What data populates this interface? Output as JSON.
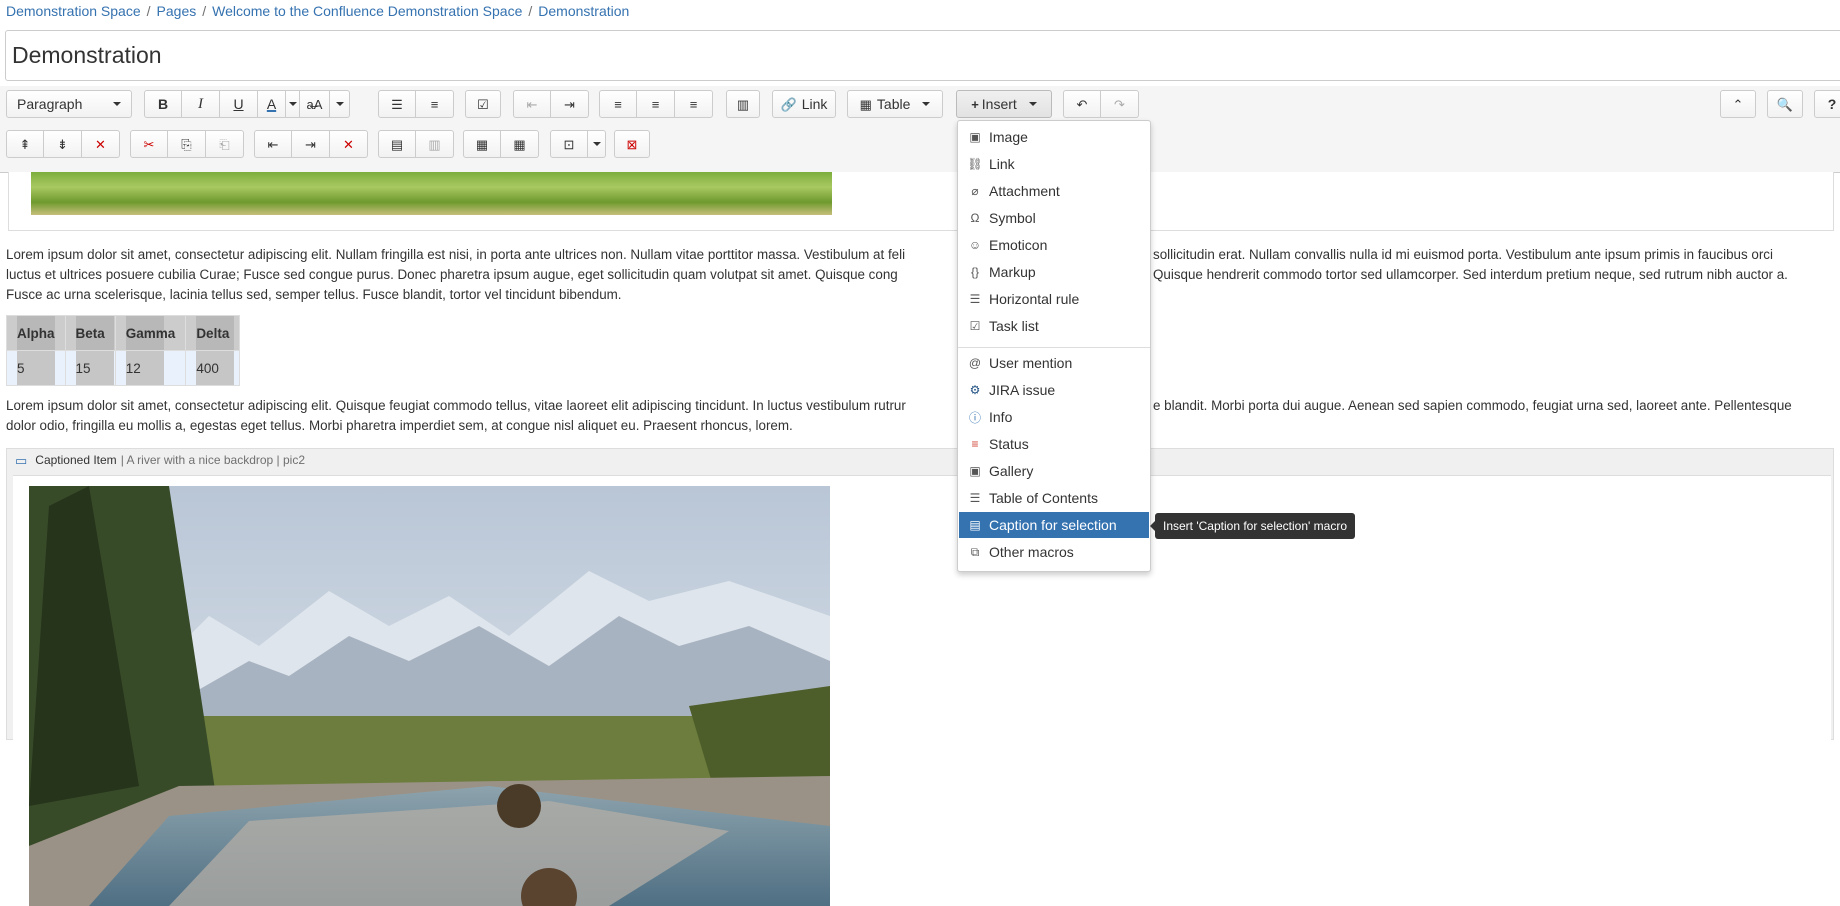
{
  "breadcrumb": {
    "items": [
      "Demonstration Space",
      "Pages",
      "Welcome to the Confluence Demonstration Space",
      "Demonstration"
    ],
    "separator": "/"
  },
  "page_title": "Demonstration",
  "toolbar": {
    "paragraph_label": "Paragraph",
    "bold": "B",
    "italic": "I",
    "underline": "U",
    "text_color": "A",
    "link_label": "Link",
    "table_label": "Table",
    "insert_label": "Insert",
    "help": "?"
  },
  "insert_menu": {
    "group1": [
      {
        "label": "Image",
        "icon": "image-icon"
      },
      {
        "label": "Link",
        "icon": "link-icon"
      },
      {
        "label": "Attachment",
        "icon": "paperclip-icon"
      },
      {
        "label": "Symbol",
        "icon": "omega-icon"
      },
      {
        "label": "Emoticon",
        "icon": "smiley-icon"
      },
      {
        "label": "Markup",
        "icon": "braces-icon"
      },
      {
        "label": "Horizontal rule",
        "icon": "hr-icon"
      },
      {
        "label": "Task list",
        "icon": "tasklist-icon"
      }
    ],
    "group2": [
      {
        "label": "User mention",
        "icon": "at-icon"
      },
      {
        "label": "JIRA issue",
        "icon": "jira-icon"
      },
      {
        "label": "Info",
        "icon": "info-icon"
      },
      {
        "label": "Status",
        "icon": "status-icon"
      },
      {
        "label": "Gallery",
        "icon": "gallery-icon"
      },
      {
        "label": "Table of Contents",
        "icon": "toc-icon"
      },
      {
        "label": "Caption for selection",
        "icon": "caption-icon"
      },
      {
        "label": "Other macros",
        "icon": "macro-icon"
      }
    ],
    "active_item": "Caption for selection",
    "tooltip": "Insert 'Caption for selection' macro"
  },
  "content": {
    "para1": "Lorem ipsum dolor sit amet, consectetur adipiscing elit. Nullam fringilla est nisi, in porta ante ultrices non. Nullam vitae porttitor massa. Vestibulum at feli",
    "para1_right": "sollicitudin erat. Nullam convallis nulla id mi euismod porta. Vestibulum ante ipsum primis in faucibus orci",
    "para1_line2a": "luctus et ultrices posuere cubilia Curae; Fusce sed congue purus. Donec pharetra ipsum augue, eget sollicitudin quam volutpat sit amet. Quisque cong",
    "para1_line2b": "Quisque hendrerit commodo tortor sed ullamcorper. Sed interdum pretium neque, sed rutrum nibh auctor a.",
    "para1_line3": "Fusce ac urna scelerisque, lacinia tellus sed, semper tellus. Fusce blandit, tortor vel tincidunt bibendum.",
    "table": {
      "headers": [
        "Alpha",
        "Beta",
        "Gamma",
        "Delta"
      ],
      "row": [
        "5",
        "15",
        "12",
        "400"
      ]
    },
    "para2_line1a": "Lorem ipsum dolor sit amet, consectetur adipiscing elit. Quisque feugiat commodo tellus, vitae laoreet elit adipiscing tincidunt. In luctus vestibulum rutrur",
    "para2_line1b": "e blandit. Morbi porta dui augue. Aenean sed sapien commodo, feugiat urna sed, laoreet ante. Pellentesque",
    "para2_line2": "dolor odio, fringilla eu mollis a, egestas eget tellus. Morbi pharetra imperdiet sem, at congue nisl aliquet eu. Praesent rhoncus, lorem.",
    "macro": {
      "name": "Captioned Item",
      "meta": "| A river with a nice backdrop | pic2"
    }
  },
  "colors": {
    "link": "#3572b0",
    "menu_active": "#3572b0",
    "tooltip_bg": "#333333"
  }
}
